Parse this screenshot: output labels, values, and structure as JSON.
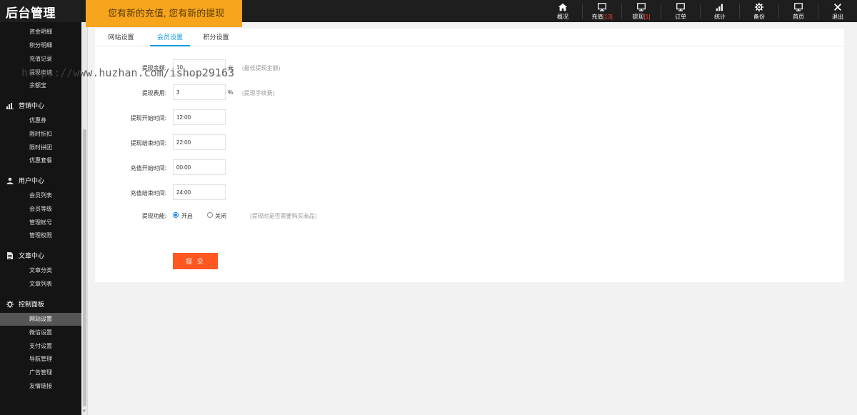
{
  "header": {
    "brand": "后台管理",
    "notice": "您有新的充值, 您有新的提现",
    "nav": [
      {
        "label": "概况",
        "count": "",
        "icon": "home-icon"
      },
      {
        "label": "充值",
        "count": "[13]",
        "icon": "monitor-icon"
      },
      {
        "label": "提现",
        "count": "[1]",
        "icon": "monitor-icon"
      },
      {
        "label": "订单",
        "count": "",
        "icon": "monitor-icon"
      },
      {
        "label": "统计",
        "count": "",
        "icon": "bar-chart-icon"
      },
      {
        "label": "备份",
        "count": "",
        "icon": "gear-icon"
      },
      {
        "label": "首页",
        "count": "",
        "icon": "monitor-icon"
      },
      {
        "label": "退出",
        "count": "",
        "icon": "close-icon"
      }
    ]
  },
  "sidebar": {
    "items": [
      {
        "label": "资金明细"
      },
      {
        "label": "积分明细"
      },
      {
        "label": "充值记录"
      },
      {
        "label": "提现申请"
      },
      {
        "label": "余额宝"
      }
    ],
    "groups": [
      {
        "label": "营销中心",
        "icon": "bar-chart-icon",
        "items": [
          "优惠券",
          "限时折扣",
          "限时拼团",
          "优惠套餐"
        ]
      },
      {
        "label": "用户中心",
        "icon": "user-icon",
        "items": [
          "会员列表",
          "会员等级",
          "管理帐号",
          "管理权限"
        ]
      },
      {
        "label": "文章中心",
        "icon": "document-icon",
        "items": [
          "文章分类",
          "文章列表"
        ]
      },
      {
        "label": "控制面板",
        "icon": "gear-icon",
        "items": [
          "网站设置",
          "微信设置",
          "支付设置",
          "导航管理",
          "广告管理",
          "友情链接"
        ]
      }
    ],
    "active": "网站设置"
  },
  "watermark": "https://www.huzhan.com/ishop29163",
  "tabs": [
    "网站设置",
    "会员设置",
    "积分设置"
  ],
  "active_tab": "会员设置",
  "form": {
    "withdraw_min": {
      "label": "提现金额:",
      "value": "10",
      "unit": "元",
      "hint": "(最低提现金额)"
    },
    "withdraw_fee": {
      "label": "提现费用:",
      "value": "3",
      "unit": "%",
      "hint": "(提现手续费)"
    },
    "withdraw_start": {
      "label": "提现开始时间:",
      "value": "12:00"
    },
    "withdraw_end": {
      "label": "提现结束时间:",
      "value": "22:00"
    },
    "recharge_start": {
      "label": "充值开始时间:",
      "value": "00:00"
    },
    "recharge_end": {
      "label": "充值结束时间:",
      "value": "24:00"
    },
    "withdraw_func": {
      "label": "提现功能:",
      "on_label": "开启",
      "off_label": "关闭",
      "hint": "(提现时是否需要购买商品)",
      "selected": "开启"
    },
    "submit_label": "提 交"
  },
  "colors": {
    "topbar": "#1e1e1e",
    "sidebar": "#141414",
    "notice_bg": "#f7a51d",
    "tab_active": "#0a9ae0",
    "submit_bg": "#ff5722"
  }
}
